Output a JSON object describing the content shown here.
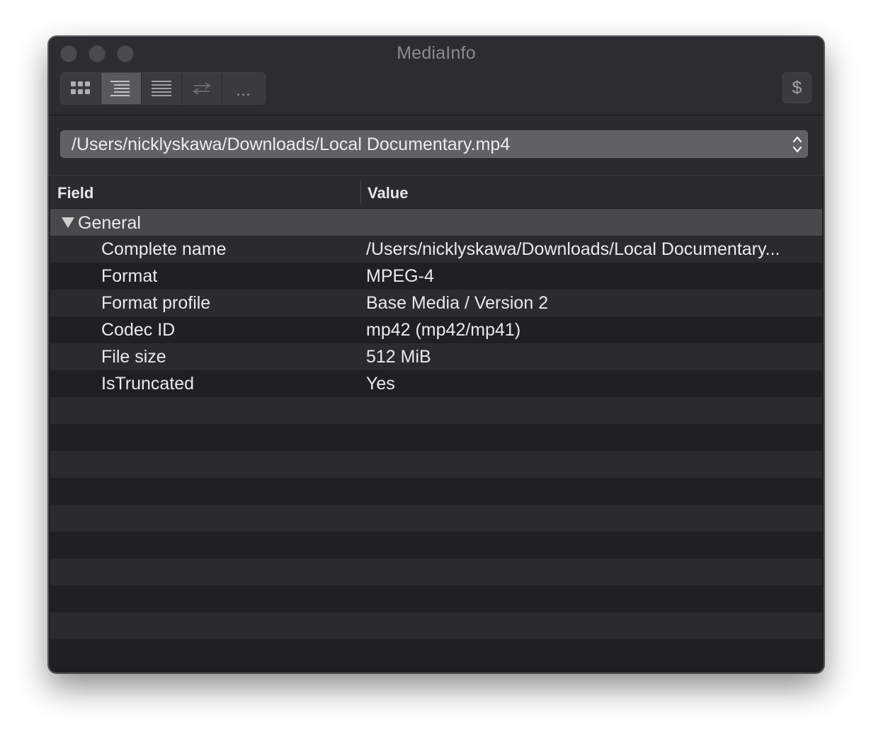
{
  "window": {
    "title": "MediaInfo"
  },
  "toolbar": {
    "view_buttons": [
      {
        "icon": "grid-view-icon",
        "active": false
      },
      {
        "icon": "tree-view-icon",
        "active": true
      },
      {
        "icon": "text-view-icon",
        "active": false
      },
      {
        "icon": "compare-view-icon",
        "active": false
      },
      {
        "icon": "more-icon",
        "label": "..."
      }
    ],
    "donate_label": "$"
  },
  "file_selector": {
    "selected_value": "/Users/nicklyskawa/Downloads/Local Documentary.mp4"
  },
  "table": {
    "columns": [
      "Field",
      "Value"
    ],
    "group": {
      "label": "General",
      "expanded": true
    },
    "rows": [
      {
        "field": "Complete name",
        "value": "/Users/nicklyskawa/Downloads/Local Documentary..."
      },
      {
        "field": "Format",
        "value": "MPEG-4"
      },
      {
        "field": "Format profile",
        "value": "Base Media / Version 2"
      },
      {
        "field": "Codec ID",
        "value": "mp42 (mp42/mp41)"
      },
      {
        "field": "File size",
        "value": "512 MiB"
      },
      {
        "field": "IsTruncated",
        "value": "Yes"
      }
    ]
  },
  "colors": {
    "window_bg": "#1e1f22",
    "toolbar_bg": "#2c2d30",
    "row_stripe": "#2a2b2e",
    "group_row": "#48494c",
    "text": "#eaeaea"
  }
}
